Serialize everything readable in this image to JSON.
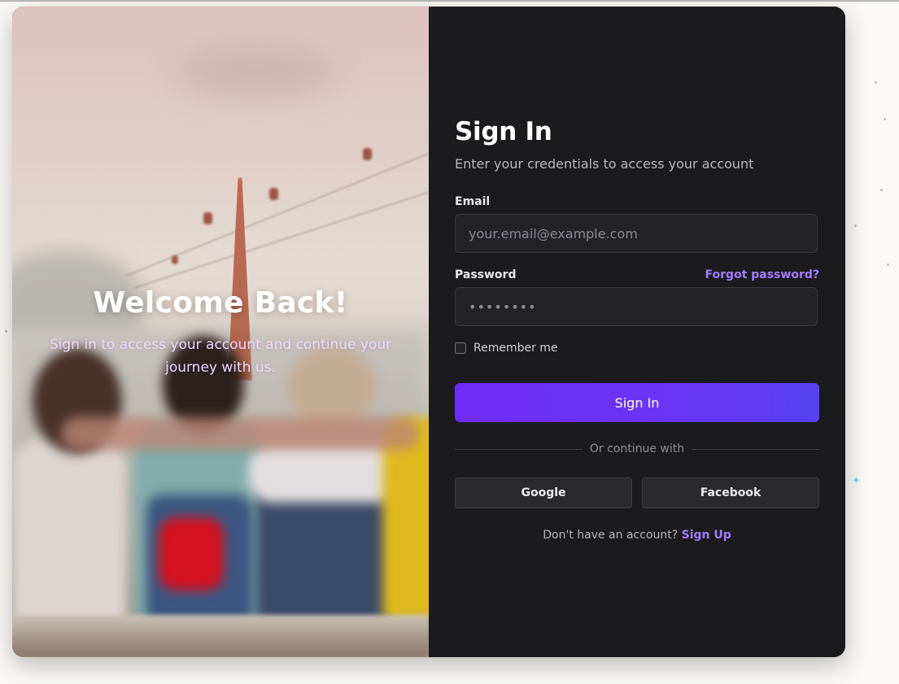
{
  "hero": {
    "title": "Welcome Back!",
    "subtitle": "Sign in to access your account and continue your journey with us."
  },
  "form": {
    "title": "Sign In",
    "subtitle": "Enter your credentials to access your account",
    "email_label": "Email",
    "email_placeholder": "your.email@example.com",
    "password_label": "Password",
    "password_value": "••••••••",
    "forgot_label": "Forgot password?",
    "remember_label": "Remember me",
    "remember_checked": false,
    "submit_label": "Sign In",
    "divider_text": "Or continue with",
    "google_label": "Google",
    "facebook_label": "Facebook",
    "footer_text": "Don't have an account? ",
    "signup_label": "Sign Up"
  },
  "colors": {
    "accent": "#6f2bf7",
    "link": "#a07dff",
    "panel_bg": "#1b1b1e",
    "input_bg": "#232327"
  }
}
